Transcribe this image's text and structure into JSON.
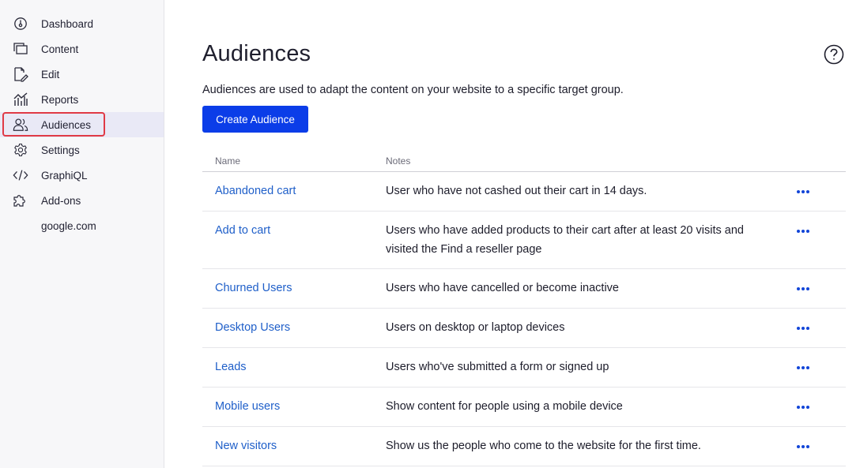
{
  "sidebar": {
    "items": [
      {
        "label": "Dashboard",
        "icon": "dashboard-icon"
      },
      {
        "label": "Content",
        "icon": "content-icon"
      },
      {
        "label": "Edit",
        "icon": "edit-icon"
      },
      {
        "label": "Reports",
        "icon": "reports-icon"
      },
      {
        "label": "Audiences",
        "icon": "audiences-icon",
        "active": true
      },
      {
        "label": "Settings",
        "icon": "settings-icon"
      },
      {
        "label": "GraphiQL",
        "icon": "code-icon"
      },
      {
        "label": "Add-ons",
        "icon": "puzzle-icon"
      },
      {
        "label": "google.com",
        "icon": ""
      }
    ]
  },
  "header": {
    "title": "Audiences",
    "description": "Audiences are used to adapt the content on your website to a specific target group.",
    "create_button": "Create Audience",
    "help_icon": "help-icon"
  },
  "table": {
    "columns": {
      "name": "Name",
      "notes": "Notes"
    },
    "rows": [
      {
        "name": "Abandoned cart",
        "notes": "User who have not cashed out their cart in 14 days."
      },
      {
        "name": "Add to cart",
        "notes": "Users who have added products to their cart after at least 20 visits and visited the Find a reseller page"
      },
      {
        "name": "Churned Users",
        "notes": "Users who have cancelled or become inactive"
      },
      {
        "name": "Desktop Users",
        "notes": "Users on desktop or laptop devices"
      },
      {
        "name": "Leads",
        "notes": "Users who've submitted a form or signed up"
      },
      {
        "name": "Mobile users",
        "notes": "Show content for people using a mobile device"
      },
      {
        "name": "New visitors",
        "notes": "Show us the people who come to the website for the first time."
      }
    ]
  },
  "colors": {
    "accent": "#0b3de8",
    "link": "#1f5fc9",
    "highlight": "#e03a46",
    "sidebar_bg": "#f7f7f9",
    "active_bg": "#e9e9f6"
  }
}
